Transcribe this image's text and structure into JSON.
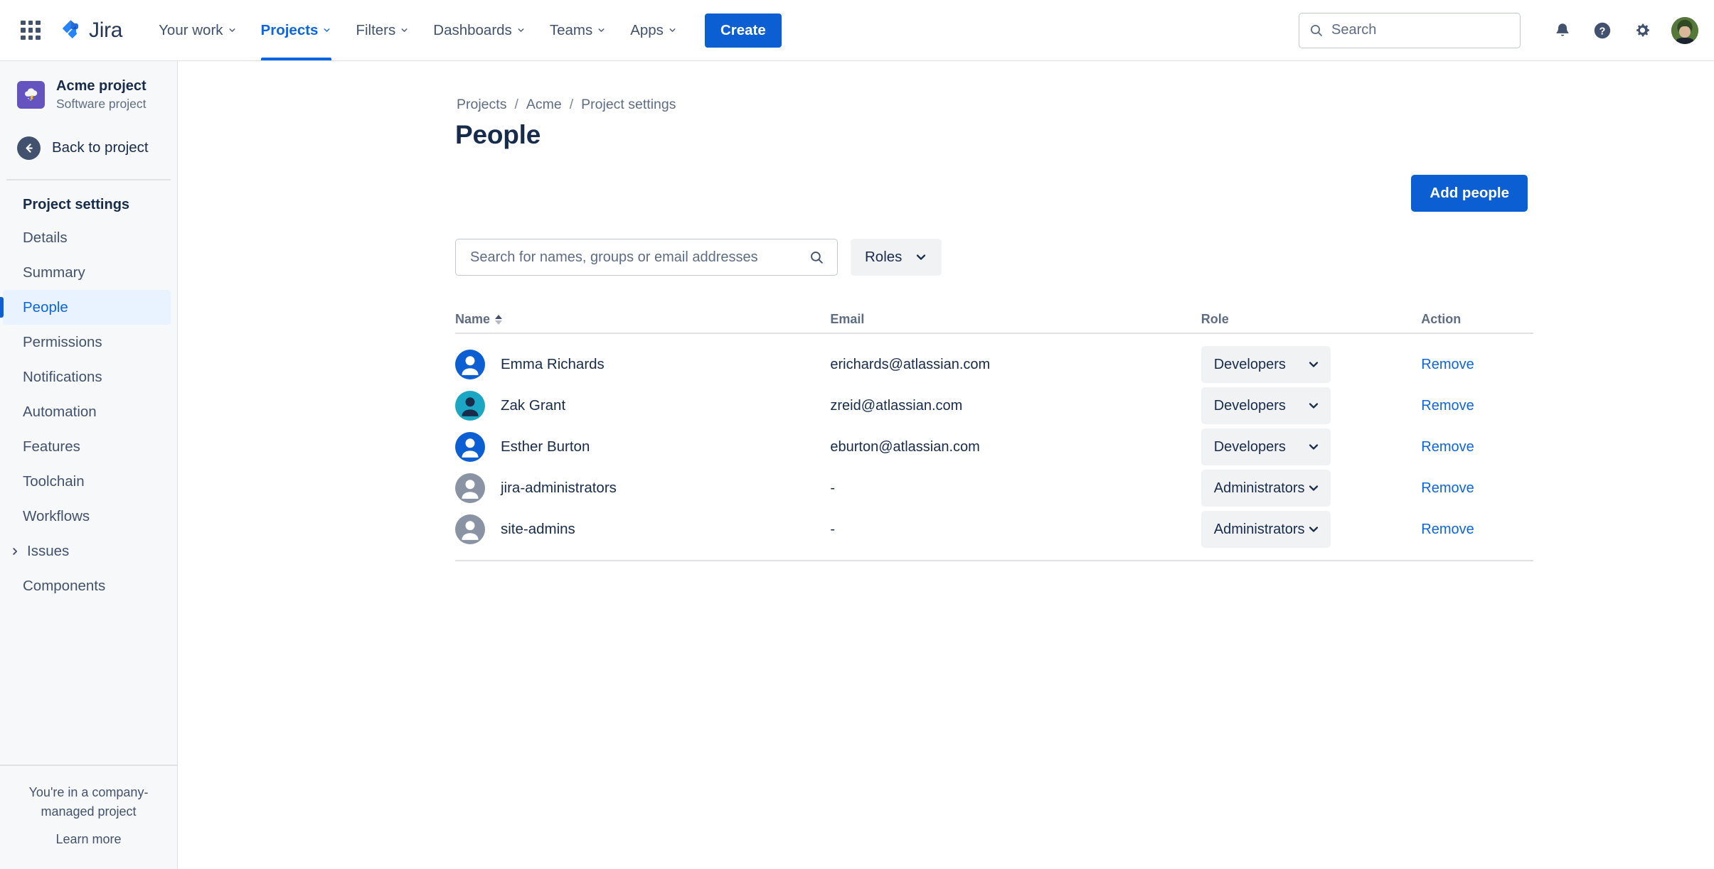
{
  "topnav": {
    "app_switcher_icon": "grid-apps-icon",
    "logo_text": "Jira",
    "items": [
      {
        "label": "Your work",
        "has_chevron": true,
        "active": false
      },
      {
        "label": "Projects",
        "has_chevron": true,
        "active": true
      },
      {
        "label": "Filters",
        "has_chevron": true,
        "active": false
      },
      {
        "label": "Dashboards",
        "has_chevron": true,
        "active": false
      },
      {
        "label": "Teams",
        "has_chevron": true,
        "active": false
      },
      {
        "label": "Apps",
        "has_chevron": true,
        "active": false
      }
    ],
    "create_label": "Create",
    "search_placeholder": "Search",
    "icons": [
      "notifications-bell-icon",
      "help-question-icon",
      "settings-gear-icon",
      "user-avatar"
    ],
    "accent_color": "#0C66E4",
    "create_button_color": "#0C5FD3"
  },
  "sidebar": {
    "project_name": "Acme project",
    "project_type": "Software project",
    "project_icon": "storm-cloud-icon",
    "project_icon_color": "#6554C0",
    "back_label": "Back to project",
    "section_title": "Project settings",
    "items": [
      {
        "label": "Details",
        "selected": false,
        "expandable": false
      },
      {
        "label": "Summary",
        "selected": false,
        "expandable": false
      },
      {
        "label": "People",
        "selected": true,
        "expandable": false
      },
      {
        "label": "Permissions",
        "selected": false,
        "expandable": false
      },
      {
        "label": "Notifications",
        "selected": false,
        "expandable": false
      },
      {
        "label": "Automation",
        "selected": false,
        "expandable": false
      },
      {
        "label": "Features",
        "selected": false,
        "expandable": false
      },
      {
        "label": "Toolchain",
        "selected": false,
        "expandable": false
      },
      {
        "label": "Workflows",
        "selected": false,
        "expandable": false
      },
      {
        "label": "Issues",
        "selected": false,
        "expandable": true
      },
      {
        "label": "Components",
        "selected": false,
        "expandable": false
      }
    ],
    "footer_text": "You're in a company-managed project",
    "footer_link": "Learn more",
    "selected_bg": "#E9F2FF",
    "selected_color": "#0C66E4"
  },
  "main": {
    "breadcrumb": [
      "Projects",
      "Acme",
      "Project settings"
    ],
    "breadcrumb_separator": "/",
    "title": "People",
    "add_people_label": "Add people",
    "search_placeholder": "Search for names, groups or email addresses",
    "search_value": "",
    "search_icon": "search-icon",
    "roles_filter_label": "Roles",
    "table": {
      "columns": [
        {
          "label": "Name",
          "sortable": true,
          "sort_direction": "asc"
        },
        {
          "label": "Email",
          "sortable": false
        },
        {
          "label": "Role",
          "sortable": false
        },
        {
          "label": "Action",
          "sortable": false
        }
      ],
      "rows": [
        {
          "name": "Emma Richards",
          "email": "erichards@atlassian.com",
          "role": "Developers",
          "action": "Remove",
          "avatar_type": "person",
          "avatar_bg": "#0C5FD3",
          "avatar_fg": "#FFFFFF"
        },
        {
          "name": "Zak Grant",
          "email": "zreid@atlassian.com",
          "role": "Developers",
          "action": "Remove",
          "avatar_type": "person",
          "avatar_bg": "#1BA7C4",
          "avatar_fg": "#1A2B4A"
        },
        {
          "name": "Esther Burton",
          "email": "eburton@atlassian.com",
          "role": "Developers",
          "action": "Remove",
          "avatar_type": "person",
          "avatar_bg": "#0C5FD3",
          "avatar_fg": "#FFFFFF"
        },
        {
          "name": "jira-administrators",
          "email": "-",
          "role": "Administrators",
          "action": "Remove",
          "avatar_type": "group",
          "avatar_bg": "#8993A4",
          "avatar_fg": "#FFFFFF"
        },
        {
          "name": "site-admins",
          "email": "-",
          "role": "Administrators",
          "action": "Remove",
          "avatar_type": "group",
          "avatar_bg": "#8993A4",
          "avatar_fg": "#FFFFFF"
        }
      ]
    }
  }
}
